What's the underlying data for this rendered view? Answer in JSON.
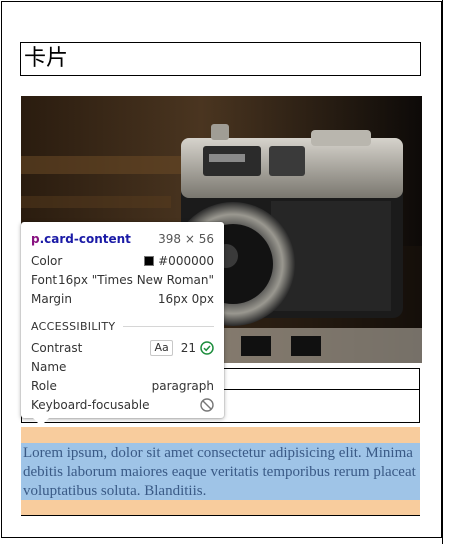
{
  "heading": {
    "text": "卡片"
  },
  "card": {
    "image_alt": "vintage camera photo",
    "content_text": "Lorem ipsum, dolor sit amet consectetur adipisicing elit. Minima debitis laborum maiores eaque veritatis temporibus rerum placeat voluptatibus soluta. Blanditiis."
  },
  "inspector": {
    "selector_tag": "p",
    "selector_class": ".card-content",
    "dimensions": "398 × 56",
    "rows": [
      {
        "label": "Color",
        "value": "#000000"
      },
      {
        "label": "Font",
        "value": "16px \"Times New Roman\""
      },
      {
        "label": "Margin",
        "value": "16px 0px"
      }
    ],
    "accessibility_heading": "ACCESSIBILITY",
    "contrast_label": "Contrast",
    "contrast_badge": "Aa",
    "contrast_value": "21",
    "name_label": "Name",
    "name_value": "",
    "role_label": "Role",
    "role_value": "paragraph",
    "focusable_label": "Keyboard-focusable"
  },
  "colors": {
    "margin_overlay": "#f8cc9d",
    "content_overlay": "#9fc4e7",
    "swatch": "#000000",
    "check_green": "#1e8e3e"
  }
}
